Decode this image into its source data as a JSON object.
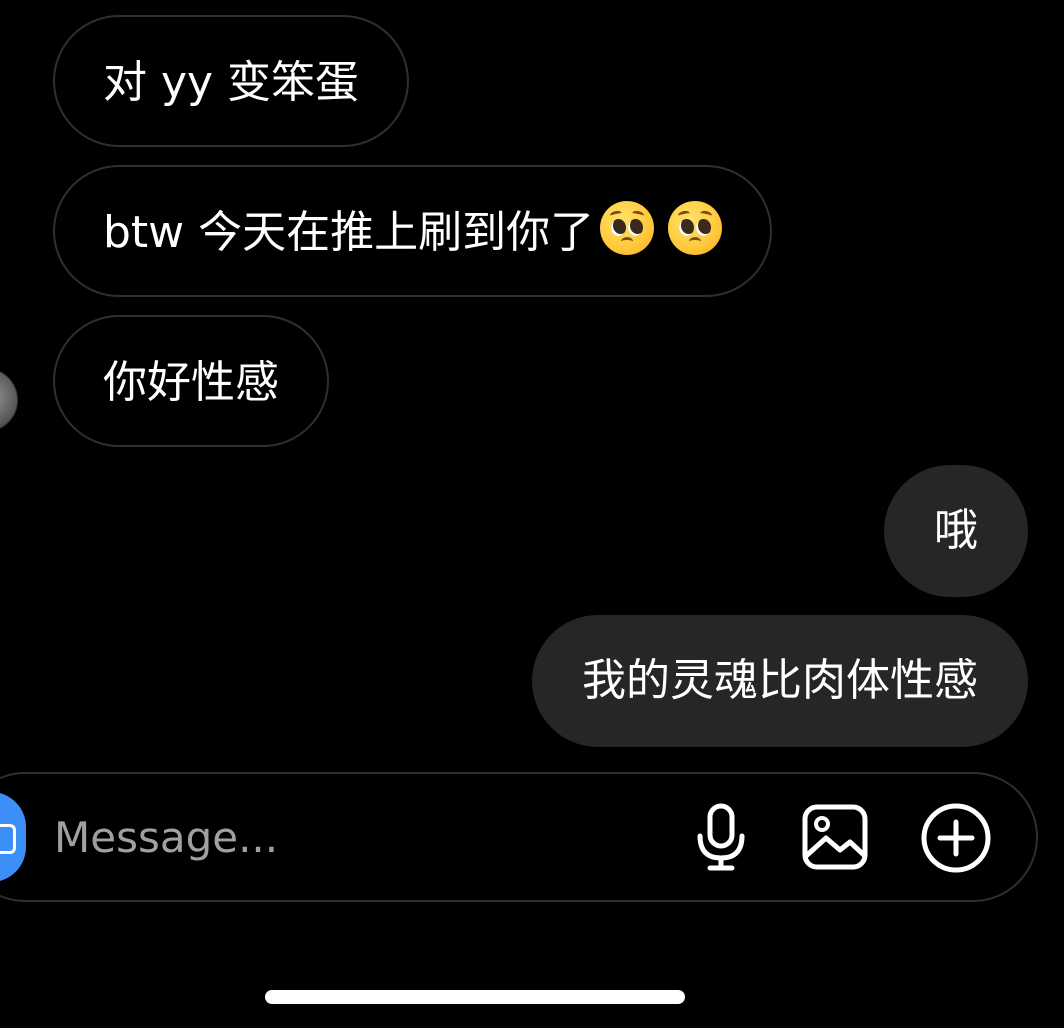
{
  "messages": [
    {
      "direction": "incoming",
      "text": "对 yy 变笨蛋"
    },
    {
      "direction": "incoming",
      "text": "btw 今天在推上刷到你了",
      "emoji": [
        "pleading-face-emoji",
        "pleading-face-emoji"
      ]
    },
    {
      "direction": "incoming",
      "text": "你好性感"
    },
    {
      "direction": "outgoing",
      "text": "哦"
    },
    {
      "direction": "outgoing",
      "text": "我的灵魂比肉体性感"
    }
  ],
  "composer": {
    "placeholder": "Message...",
    "icons": [
      "camera-icon",
      "microphone-icon",
      "gallery-icon",
      "add-icon"
    ]
  },
  "colors": {
    "background": "#000000",
    "incoming_border": "#2f2f2f",
    "outgoing_bubble": "#262626",
    "accent": "#3b8ff6",
    "placeholder": "#a0a0a0"
  }
}
